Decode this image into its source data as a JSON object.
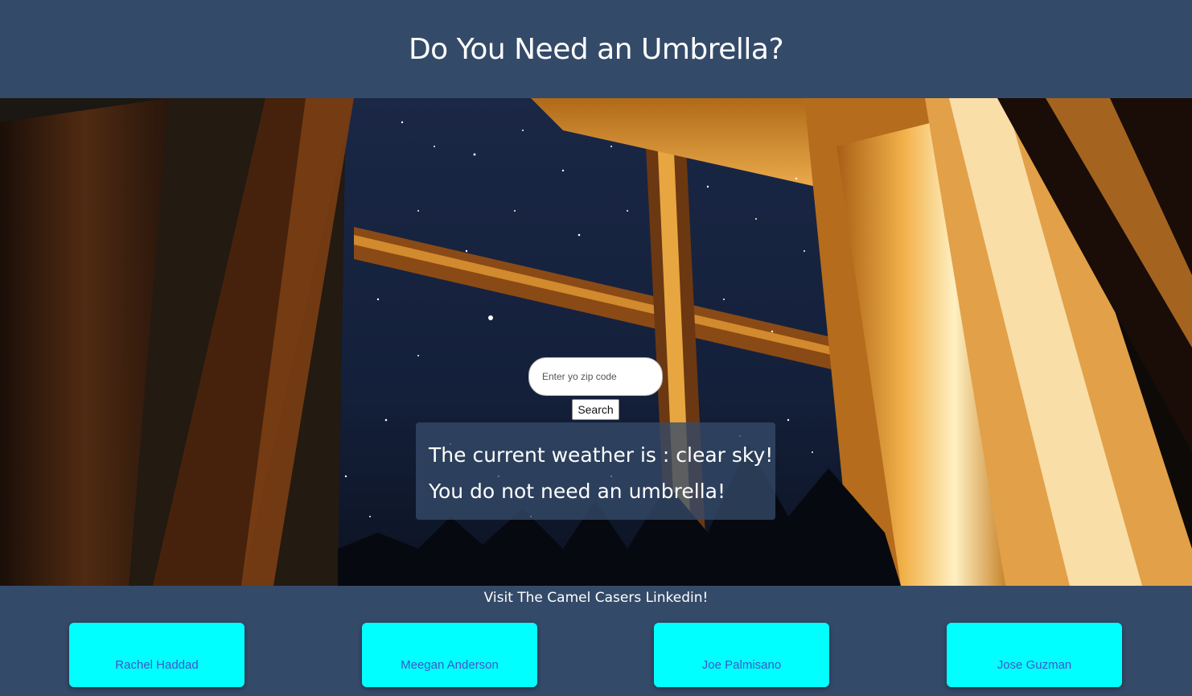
{
  "header": {
    "title": "Do You Need an Umbrella?"
  },
  "search": {
    "placeholder": "Enter yo zip code",
    "value": "",
    "button_label": "Search"
  },
  "result": {
    "weather_line": "The current weather is : clear sky!",
    "umbrella_line": "You do not need an umbrella!"
  },
  "footer": {
    "title": "Visit The Camel Casers Linkedin!",
    "members": [
      {
        "name": "Rachel Haddad"
      },
      {
        "name": "Meegan Anderson"
      },
      {
        "name": "Joe Palmisano"
      },
      {
        "name": "Jose Guzman"
      }
    ]
  },
  "colors": {
    "header_bg": "#344a69",
    "card_bg": "#00ffff",
    "card_text": "#3f57c6",
    "text_light": "#ffffff"
  }
}
